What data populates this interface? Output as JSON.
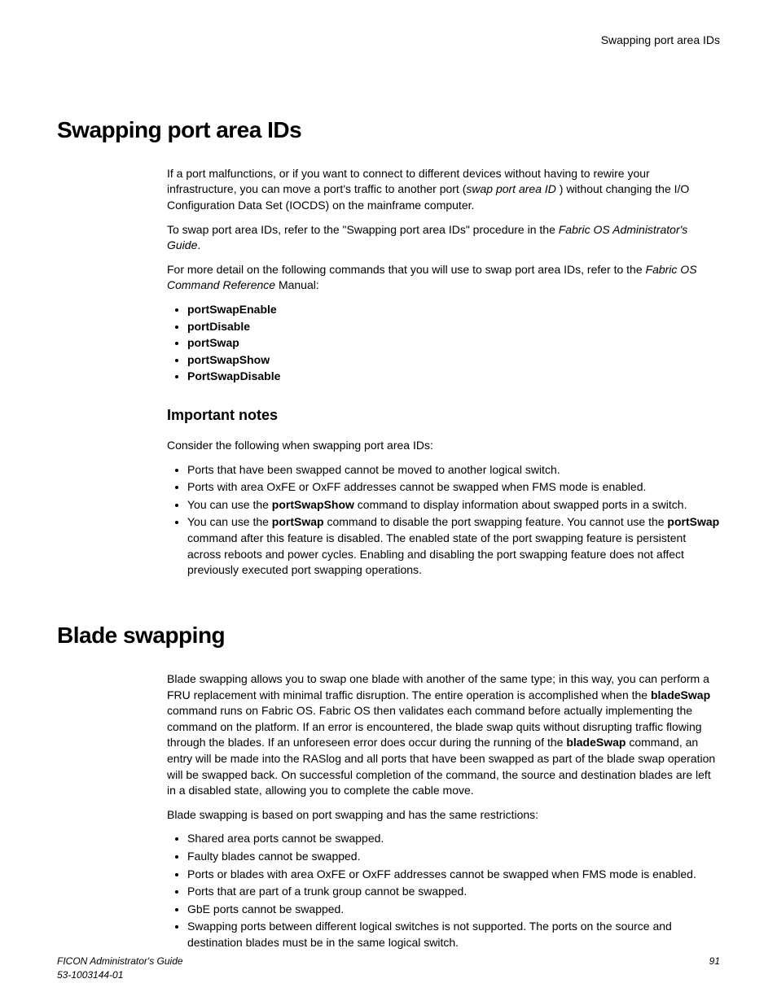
{
  "header": {
    "right": "Swapping port area IDs"
  },
  "h1_1": "Swapping port area IDs",
  "p1a": "If a port malfunctions, or if you want to connect to different devices without having to rewire your infrastructure, you can move a port's traffic to another port (",
  "p1b": "swap port area ID",
  "p1c": " ) without changing the I/O Configuration Data Set (IOCDS) on the mainframe computer.",
  "p2a": "To swap port area IDs, refer to the \"Swapping port area IDs\" procedure in the ",
  "p2b": "Fabric OS Administrator's Guide",
  "p2c": ".",
  "p3a": "For more detail on the following commands that you will use to swap port area IDs, refer to the ",
  "p3b": "Fabric OS Command Reference",
  "p3c": " Manual:",
  "cmds": {
    "c1": "portSwapEnable",
    "c2": "portDisable",
    "c3": "portSwap",
    "c4": "portSwapShow",
    "c5": "PortSwapDisable"
  },
  "h2_1": "Important notes",
  "p4": "Consider the following when swapping port area IDs:",
  "n1": "Ports that have been swapped cannot be moved to another logical switch.",
  "n2": "Ports with area OxFE or OxFF addresses cannot be swapped when FMS mode is enabled.",
  "n3a": "You can use the ",
  "n3b": "portSwapShow",
  "n3c": " command to display information about swapped ports in a switch.",
  "n4a": "You can use the ",
  "n4b": "portSwap",
  "n4c": " command to disable the port swapping feature. You cannot use the ",
  "n4d": "portSwap",
  "n4e": " command after this feature is disabled. The enabled state of the port swapping feature is persistent across reboots and power cycles. Enabling and disabling the port swapping feature does not affect previously executed port swapping operations.",
  "h1_2": "Blade swapping",
  "p5a": "Blade swapping allows you to swap one blade with another of the same type; in this way, you can perform a FRU replacement with minimal traffic disruption. The entire operation is accomplished when the ",
  "p5b": "bladeSwap",
  "p5c": " command runs on Fabric OS. Fabric OS then validates each command before actually implementing the command on the platform. If an error is encountered, the blade swap quits without disrupting traffic flowing through the blades. If an unforeseen error does occur during the running of the ",
  "p5d": "bladeSwap",
  "p5e": " command, an entry will be made into the RASlog and all ports that have been swapped as part of the blade swap operation will be swapped back. On successful completion of the command, the source and destination blades are left in a disabled state, allowing you to complete the cable move.",
  "p6": "Blade swapping is based on port swapping and has the same restrictions:",
  "r1": "Shared area ports cannot be swapped.",
  "r2": "Faulty blades cannot be swapped.",
  "r3": "Ports or blades with area OxFE or OxFF addresses cannot be swapped when FMS mode is enabled.",
  "r4": "Ports that are part of a trunk group cannot be swapped.",
  "r5": "GbE ports cannot be swapped.",
  "r6": "Swapping ports between different logical switches is not supported. The ports on the source and destination blades must be in the same logical switch.",
  "footer": {
    "title": "FICON Administrator's Guide",
    "doc": "53-1003144-01",
    "page": "91"
  }
}
